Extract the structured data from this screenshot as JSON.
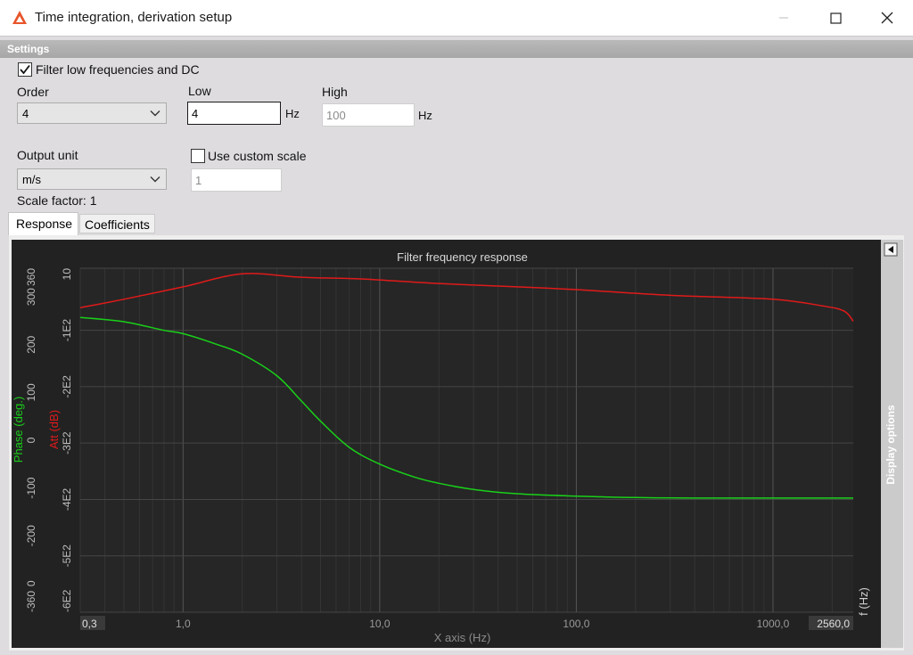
{
  "window": {
    "title": "Time integration, derivation setup",
    "controls": [
      "minimize",
      "maximize",
      "close"
    ]
  },
  "settings": {
    "header": "Settings",
    "filter_checkbox": {
      "label": "Filter low frequencies and DC",
      "checked": true
    },
    "order": {
      "label": "Order",
      "value": "4"
    },
    "low": {
      "label": "Low",
      "value": "4",
      "unit": "Hz"
    },
    "high": {
      "label": "High",
      "value": "100",
      "unit": "Hz"
    },
    "output_unit": {
      "label": "Output unit",
      "value": "m/s"
    },
    "custom_scale": {
      "label": "Use custom scale",
      "checked": false,
      "value": "1"
    },
    "scale_factor": "Scale factor: 1"
  },
  "tabs": [
    {
      "label": "Response",
      "active": true
    },
    {
      "label": "Coefficients",
      "active": false
    }
  ],
  "display_options_label": "Display options",
  "colors": {
    "att": "#e01a1a",
    "phase": "#19d019",
    "plot_bg": "#262626",
    "grid": "#4a4a4a"
  },
  "chart_data": {
    "type": "line",
    "title": "Filter frequency response",
    "xlabel": "X axis (Hz)",
    "x_unit_label": "f (Hz)",
    "x_scale": "log",
    "xlim": [
      0.3,
      2560
    ],
    "x_ticks": [
      {
        "value": 0.3,
        "label": "0,3"
      },
      {
        "value": 1,
        "label": "1,0"
      },
      {
        "value": 10,
        "label": "10,0"
      },
      {
        "value": 100,
        "label": "100,0"
      },
      {
        "value": 1000,
        "label": "1000,0"
      },
      {
        "value": 2560,
        "label": "2560,0"
      }
    ],
    "y_left": {
      "label": "Phase (deg.)",
      "ylim": [
        -360,
        360
      ],
      "ticks": [
        {
          "value": 360,
          "label": "360"
        },
        {
          "value": 300,
          "label": "300"
        },
        {
          "value": 200,
          "label": "200"
        },
        {
          "value": 100,
          "label": "100"
        },
        {
          "value": 0,
          "label": "0"
        },
        {
          "value": -100,
          "label": "-100"
        },
        {
          "value": -200,
          "label": "-200"
        },
        {
          "value": -300,
          "label": "0"
        },
        {
          "value": -360,
          "label": "-360"
        }
      ]
    },
    "y_right": {
      "label": "Att (dB)",
      "ylim": [
        -600,
        10
      ],
      "ticks": [
        {
          "value": 10,
          "label": "10"
        },
        {
          "value": -100,
          "label": "-1E2"
        },
        {
          "value": -200,
          "label": "-2E2"
        },
        {
          "value": -300,
          "label": "-3E2"
        },
        {
          "value": -400,
          "label": "-4E2"
        },
        {
          "value": -500,
          "label": "-5E2"
        },
        {
          "value": -600,
          "label": "-6E2"
        }
      ]
    },
    "series": [
      {
        "name": "Att (dB)",
        "axis": "right",
        "points": [
          [
            0.3,
            -60
          ],
          [
            0.5,
            -45
          ],
          [
            1,
            -23
          ],
          [
            2,
            0
          ],
          [
            4,
            -6
          ],
          [
            8,
            -9
          ],
          [
            20,
            -17
          ],
          [
            50,
            -23
          ],
          [
            100,
            -28
          ],
          [
            300,
            -38
          ],
          [
            1000,
            -45
          ],
          [
            1800,
            -57
          ],
          [
            2300,
            -66
          ],
          [
            2560,
            -84
          ]
        ]
      },
      {
        "name": "Phase (deg.)",
        "axis": "left",
        "points": [
          [
            0.3,
            257
          ],
          [
            0.5,
            248
          ],
          [
            0.8,
            230
          ],
          [
            1,
            223
          ],
          [
            1.5,
            200
          ],
          [
            2,
            180
          ],
          [
            3,
            135
          ],
          [
            4,
            82
          ],
          [
            5,
            40
          ],
          [
            7,
            -15
          ],
          [
            10,
            -50
          ],
          [
            15,
            -77
          ],
          [
            20,
            -90
          ],
          [
            30,
            -103
          ],
          [
            50,
            -112
          ],
          [
            100,
            -117
          ],
          [
            200,
            -120
          ],
          [
            400,
            -121
          ],
          [
            1000,
            -121
          ],
          [
            2560,
            -121
          ]
        ]
      }
    ]
  }
}
